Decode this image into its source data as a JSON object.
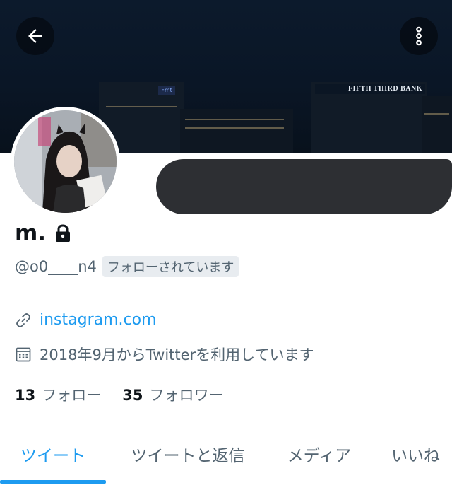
{
  "banner": {
    "sign_text": "FIFTH THIRD BANK",
    "small_sign_text": "Fmt"
  },
  "profile": {
    "name": "m.",
    "handle": "@o0____n4",
    "follows_you_badge": "フォローされています",
    "website": "instagram.com",
    "joined": "2018年9月からTwitterを利用しています"
  },
  "counts": {
    "following_count": "13",
    "following_label": "フォロー",
    "followers_count": "35",
    "followers_label": "フォロワー"
  },
  "tabs": [
    {
      "label": "ツイート",
      "active": true
    },
    {
      "label": "ツイートと返信",
      "active": false
    },
    {
      "label": "メディア",
      "active": false
    },
    {
      "label": "いいね",
      "active": false
    }
  ],
  "colors": {
    "accent": "#1d9bf0",
    "text_primary": "#0f1419",
    "text_secondary": "#536471"
  },
  "icons": {
    "back": "arrow-left-icon",
    "more": "vertical-dots-icon",
    "lock": "lock-icon",
    "link": "link-icon",
    "calendar": "calendar-icon"
  }
}
